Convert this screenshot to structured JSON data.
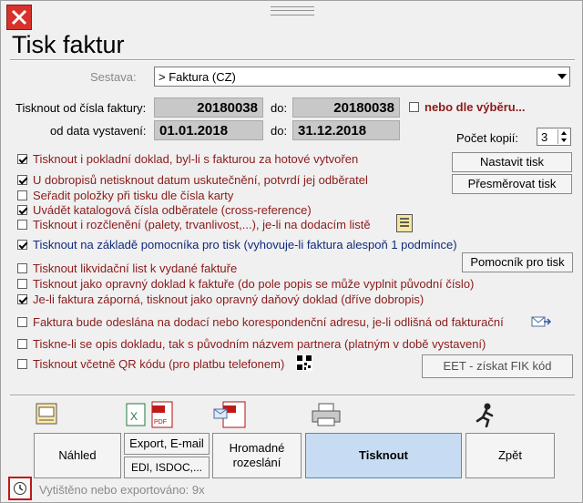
{
  "window": {
    "title": "Tisk faktur"
  },
  "sestava": {
    "label": "Sestava:",
    "value": "> Faktura (CZ)"
  },
  "range": {
    "from_label": "Tisknout od čísla faktury:",
    "from_value": "20180038",
    "do1_label": "do:",
    "to_value": "20180038",
    "nebo_label": "nebo dle výběru...",
    "date_label": "od data vystavení:",
    "date_from": "01.01.2018",
    "do2_label": "do:",
    "date_to": "31.12.2018"
  },
  "copies": {
    "label": "Počet kopií:",
    "value": "3"
  },
  "side_buttons": {
    "nastavit": "Nastavit tisk",
    "presmerovat": "Přesměrovat tisk",
    "pomocnik": "Pomocník pro tisk",
    "eet": "EET - získat FIK kód"
  },
  "options": [
    {
      "label": "Tisknout i pokladní doklad, byl-li s fakturou za hotové vytvořen",
      "checked": true
    },
    {
      "label": "U dobropisů netisknout datum uskutečnění, potvrdí jej odběratel",
      "checked": true
    },
    {
      "label": "Seřadit položky při tisku dle čísla karty",
      "checked": false
    },
    {
      "label": "Uvádět katalogová čísla odběratele (cross-reference)",
      "checked": true
    },
    {
      "label": "Tisknout i rozčlenění (palety, trvanlivost,...), je-li na dodacím listě",
      "checked": false
    },
    {
      "label": "Tisknout na základě pomocníka pro tisk (vyhovuje-li faktura alespoň 1 podmínce)",
      "checked": true
    },
    {
      "label": "Tisknout likvidační list k vydané faktuře",
      "checked": false
    },
    {
      "label": "Tisknout jako opravný doklad k faktuře (do pole popis se může vyplnit původní číslo)",
      "checked": false
    },
    {
      "label": "Je-li faktura záporná, tisknout jako opravný daňový doklad (dříve dobropis)",
      "checked": true
    },
    {
      "label": "Faktura bude odeslána na dodací nebo korespondenční adresu, je-li odlišná od fakturační",
      "checked": false
    },
    {
      "label": "Tiskne-li se opis dokladu, tak s původním názvem partnera (platným v době vystavení)",
      "checked": false
    },
    {
      "label": "Tisknout včetně QR kódu (pro platbu telefonem)",
      "checked": false
    }
  ],
  "bottom": {
    "nahled": "Náhled",
    "export": "Export, E-mail",
    "edi": "EDI, ISDOC,...",
    "hromadne": "Hromadné rozeslání",
    "tisknout": "Tisknout",
    "zpet": "Zpět"
  },
  "status": "Vytištěno nebo exportováno: 9x",
  "colors": {
    "accent": "#c7dcf2",
    "close": "#d8312b",
    "option_text": "#8b1a1a",
    "option_blue": "#102a7a"
  }
}
